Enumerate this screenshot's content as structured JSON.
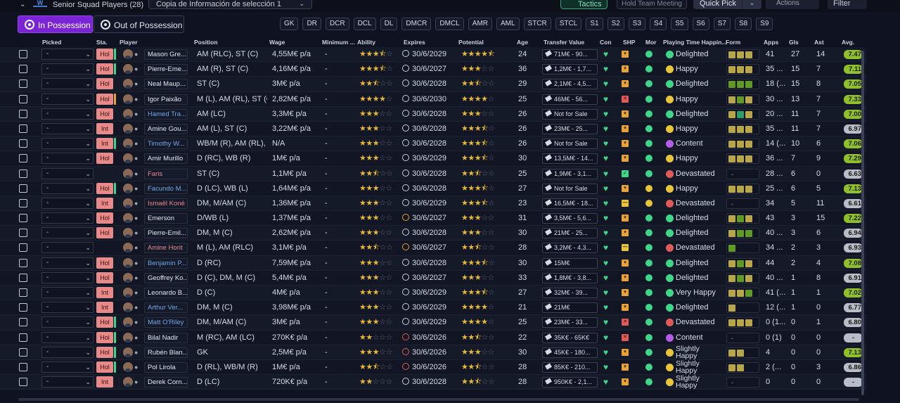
{
  "topbar": {
    "squad_title": "Senior Squad Players (28)",
    "selection_dropdown": "Copia de Información de selección 1",
    "tactics": "Tactics",
    "hold_team_meeting": "Hold Team Meeting",
    "quick_pick": "Quick Pick",
    "actions": "Actions",
    "filter": "Filter"
  },
  "possession": {
    "in": "In Possession",
    "out": "Out of Possession"
  },
  "positions": [
    "GK",
    "DR",
    "DCR",
    "DCL",
    "DL",
    "DMCR",
    "DMCL",
    "AMR",
    "AML",
    "STCR",
    "STCL",
    "S1",
    "S2",
    "S3",
    "S4",
    "S5",
    "S6",
    "S7",
    "S8",
    "S9"
  ],
  "columns": {
    "picked": "Picked",
    "sta": "Sta.",
    "player": "Player",
    "position": "Position",
    "wage": "Wage",
    "minimum": "Minimum ...",
    "ability": "Ability",
    "expires": "Expires",
    "potential": "Potential",
    "age": "Age",
    "transfer_value": "Transfer Value",
    "con": "Con",
    "shp": "SHP",
    "mor": "Mor",
    "happiness": "Playing Time Happin...",
    "form": "Form",
    "apps": "Apps",
    "gls": "Gls",
    "ast": "Ast",
    "avg": "Avg."
  },
  "colors": {
    "accent_purple": "#7a24d6",
    "tactics_green": "#2fa37a",
    "star": "#e8b931",
    "happy_green": "#3fd68a",
    "happy_yellow": "#e8c53a",
    "sad_red": "#e05a5a",
    "content_purple": "#b45be8"
  },
  "rows": [
    {
      "picked": "-",
      "sta": "Hol",
      "cond": "g",
      "name": "Mason Gre...",
      "name_color": "white",
      "position": "AM (RLC), ST (C)",
      "wage": "4,55M€ p/a",
      "min": "-",
      "ability": 3.5,
      "expires": "30/6/2029",
      "exp": "n",
      "potential": 4.5,
      "age": "24",
      "tv": "71M€ - 90...",
      "con": "g",
      "shp": "o",
      "mor": "g",
      "happy": "Delighted",
      "hc": "g",
      "form": [
        "y",
        "y",
        "y"
      ],
      "apps": "41",
      "gls": "27",
      "ast": "14",
      "avg": "7.47",
      "avgc": "#8fbf2a"
    },
    {
      "picked": "-",
      "sta": "Hol",
      "cond": "g",
      "name": "Pierre-Eme...",
      "name_color": "white",
      "position": "AM (R), ST (C)",
      "wage": "4,16M€ p/a",
      "min": "-",
      "ability": 3.5,
      "expires": "30/6/2027",
      "exp": "n",
      "potential": 3,
      "age": "36",
      "tv": "1,2M€ - 1,7...",
      "con": "g",
      "shp": "o",
      "mor": "g",
      "happy": "Happy",
      "hc": "y",
      "form": [
        "y",
        "y",
        "y"
      ],
      "apps": "35 ...",
      "gls": "15",
      "ast": "7",
      "avg": "7.11",
      "avgc": "#8fbf2a"
    },
    {
      "picked": "-",
      "sta": "Hol",
      "cond": "",
      "name": "Neal Maup...",
      "name_color": "white",
      "position": "ST (C)",
      "wage": "3M€ p/a",
      "min": "-",
      "ability": 2.5,
      "expires": "30/6/2028",
      "exp": "n",
      "potential": 2.5,
      "age": "29",
      "tv": "2,1M€ - 4,5...",
      "con": "g",
      "shp": "o",
      "mor": "g",
      "happy": "Delighted",
      "hc": "g",
      "form": [
        "g",
        "g",
        "g"
      ],
      "apps": "18 (...",
      "gls": "15",
      "ast": "8",
      "avg": "7.05",
      "avgc": "#8fbf2a"
    },
    {
      "picked": "-",
      "sta": "Hol",
      "cond": "o",
      "name": "Igor Paixão",
      "name_color": "white",
      "position": "M (L), AM (RL), ST (C)",
      "wage": "2,82M€ p/a",
      "min": "-",
      "ability": 4,
      "expires": "30/6/2030",
      "exp": "n",
      "potential": 4,
      "age": "25",
      "tv": "46M€ - 56...",
      "con": "g",
      "shp": "r",
      "mor": "g",
      "happy": "Happy",
      "hc": "y",
      "form": [
        "y",
        "g",
        "y"
      ],
      "apps": "30 ...",
      "gls": "13",
      "ast": "7",
      "avg": "7.33",
      "avgc": "#8fbf2a"
    },
    {
      "picked": "-",
      "sta": "Hol",
      "cond": "",
      "name": "Hamed Tra...",
      "name_color": "blue",
      "position": "AM (LC)",
      "wage": "3,3M€ p/a",
      "min": "-",
      "ability": 3,
      "expires": "30/6/2028",
      "exp": "n",
      "potential": 3,
      "age": "26",
      "tv": "Not for Sale",
      "con": "g",
      "shp": "o",
      "mor": "g",
      "happy": "Delighted",
      "hc": "g",
      "form": [
        "y",
        "t",
        "y"
      ],
      "apps": "20 ...",
      "gls": "11",
      "ast": "7",
      "avg": "7.00",
      "avgc": "#8fbf2a"
    },
    {
      "picked": "-",
      "sta": "Int",
      "cond": "",
      "name": "Amine Gou...",
      "name_color": "white",
      "position": "AM (L), ST (C)",
      "wage": "3,22M€ p/a",
      "min": "-",
      "ability": 3,
      "expires": "30/6/2028",
      "exp": "n",
      "potential": 3.5,
      "age": "26",
      "tv": "23M€ - 25...",
      "con": "g",
      "shp": "o",
      "mor": "g",
      "happy": "Happy",
      "hc": "y",
      "form": [
        "y",
        "y",
        "y"
      ],
      "apps": "35 ...",
      "gls": "11",
      "ast": "7",
      "avg": "6.97",
      "avgc": "#b8bdc9"
    },
    {
      "picked": "-",
      "sta": "Int",
      "cond": "g",
      "name": "Timothy W...",
      "name_color": "blue",
      "position": "WB/M (R), AM (RL), ...",
      "wage": "N/A",
      "min": "-",
      "ability": 3,
      "expires": "30/6/2028",
      "exp": "n",
      "potential": 3.5,
      "age": "26",
      "tv": "Not for Sale",
      "con": "g",
      "shp": "o",
      "mor": "g",
      "happy": "Content",
      "hc": "p",
      "form": [
        "y",
        "y",
        "y"
      ],
      "apps": "14 (...",
      "gls": "10",
      "ast": "6",
      "avg": "7.06",
      "avgc": "#8fbf2a"
    },
    {
      "picked": "-",
      "sta": "Hol",
      "cond": "",
      "name": "Amir Murillo",
      "name_color": "white",
      "position": "D (RC), WB (R)",
      "wage": "1M€ p/a",
      "min": "-",
      "ability": 3,
      "expires": "30/6/2029",
      "exp": "n",
      "potential": 3.5,
      "age": "30",
      "tv": "13,5M€ - 14...",
      "con": "g",
      "shp": "o",
      "mor": "g",
      "happy": "Happy",
      "hc": "y",
      "form": [
        "y",
        "y",
        "y"
      ],
      "apps": "36 ...",
      "gls": "7",
      "ast": "9",
      "avg": "7.29",
      "avgc": "#8fbf2a"
    },
    {
      "picked": "-",
      "sta": "",
      "cond": "",
      "name": "Faris",
      "name_color": "red",
      "position": "ST (C)",
      "wage": "1,1M€ p/a",
      "min": "-",
      "ability": 2.5,
      "expires": "30/6/2028",
      "exp": "n",
      "potential": 2.5,
      "age": "25",
      "tv": "1,9M€ - 3,1...",
      "con": "g",
      "shp": "gr",
      "mor": "g",
      "happy": "Devastated",
      "hc": "r",
      "form": [],
      "apps": "28 ...",
      "gls": "6",
      "ast": "0",
      "avg": "6.63",
      "avgc": "#b8bdc9"
    },
    {
      "picked": "-",
      "sta": "Hol",
      "cond": "g",
      "name": "Facundo M...",
      "name_color": "blue",
      "position": "D (LC), WB (L)",
      "wage": "1,64M€ p/a",
      "min": "-",
      "ability": 3,
      "expires": "30/6/2028",
      "exp": "n",
      "potential": 3.5,
      "age": "27",
      "tv": "Not for Sale",
      "con": "g",
      "shp": "o",
      "mor": "y",
      "happy": "Happy",
      "hc": "y",
      "form": [
        "y",
        "y",
        "y"
      ],
      "apps": "25 ...",
      "gls": "6",
      "ast": "5",
      "avg": "7.13",
      "avgc": "#8fbf2a"
    },
    {
      "picked": "-",
      "sta": "Int",
      "cond": "",
      "name": "Ismaël Koné",
      "name_color": "red",
      "position": "DM, M/AM (C)",
      "wage": "1,36M€ p/a",
      "min": "-",
      "ability": 3,
      "expires": "30/6/2029",
      "exp": "n",
      "potential": 3.5,
      "age": "23",
      "tv": "16,5M€ - 18...",
      "con": "g",
      "shp": "ye",
      "mor": "y",
      "happy": "Devastated",
      "hc": "r",
      "form": [],
      "apps": "34",
      "gls": "5",
      "ast": "11",
      "avg": "6.61",
      "avgc": "#b8bdc9"
    },
    {
      "picked": "-",
      "sta": "Hol",
      "cond": "",
      "name": "Emerson",
      "name_color": "white",
      "position": "D/WB (L)",
      "wage": "1,37M€ p/a",
      "min": "-",
      "ability": 3,
      "expires": "30/6/2027",
      "exp": "o",
      "potential": 3,
      "age": "31",
      "tv": "3,5M€ - 5,6...",
      "con": "g",
      "shp": "o",
      "mor": "g",
      "happy": "Delighted",
      "hc": "g",
      "form": [
        "y",
        "g",
        "y"
      ],
      "apps": "43",
      "gls": "3",
      "ast": "15",
      "avg": "7.22",
      "avgc": "#8fbf2a"
    },
    {
      "picked": "-",
      "sta": "Hol",
      "cond": "",
      "name": "Pierre-Emil...",
      "name_color": "white",
      "position": "DM, M (C)",
      "wage": "2,62M€ p/a",
      "min": "-",
      "ability": 3,
      "expires": "30/6/2028",
      "exp": "n",
      "potential": 3,
      "age": "30",
      "tv": "21M€ - 25...",
      "con": "g",
      "shp": "o",
      "mor": "g",
      "happy": "Delighted",
      "hc": "g",
      "form": [
        "y",
        "g",
        "g"
      ],
      "apps": "40 ...",
      "gls": "3",
      "ast": "6",
      "avg": "6.94",
      "avgc": "#b8bdc9"
    },
    {
      "picked": "-",
      "sta": "",
      "cond": "",
      "name": "Amine Horit",
      "name_color": "red",
      "position": "M (L), AM (RLC)",
      "wage": "3,1M€ p/a",
      "min": "-",
      "ability": 2.5,
      "expires": "30/6/2027",
      "exp": "o",
      "potential": 2.5,
      "age": "28",
      "tv": "3,2M€ - 4,3...",
      "con": "g",
      "shp": "ye",
      "mor": "g",
      "happy": "Devastated",
      "hc": "r",
      "form": [
        "g"
      ],
      "apps": "34 ...",
      "gls": "2",
      "ast": "3",
      "avg": "6.93",
      "avgc": "#b8bdc9"
    },
    {
      "picked": "-",
      "sta": "Hol",
      "cond": "",
      "name": "Benjamin P...",
      "name_color": "blue",
      "position": "D (RC)",
      "wage": "7,59M€ p/a",
      "min": "-",
      "ability": 3,
      "expires": "30/6/2028",
      "exp": "n",
      "potential": 3.5,
      "age": "30",
      "tv": "15M€",
      "con": "g",
      "shp": "o",
      "mor": "g",
      "happy": "Delighted",
      "hc": "g",
      "form": [
        "y",
        "g",
        "y"
      ],
      "apps": "44",
      "gls": "2",
      "ast": "4",
      "avg": "7.08",
      "avgc": "#8fbf2a"
    },
    {
      "picked": "-",
      "sta": "Hol",
      "cond": "",
      "name": "Geoffrey Ko...",
      "name_color": "white",
      "position": "D (C), DM, M (C)",
      "wage": "5,4M€ p/a",
      "min": "-",
      "ability": 3,
      "expires": "30/6/2027",
      "exp": "n",
      "potential": 3,
      "age": "33",
      "tv": "1,8M€ - 3,8...",
      "con": "g",
      "shp": "o",
      "mor": "g",
      "happy": "Delighted",
      "hc": "g",
      "form": [
        "y",
        "g",
        "y"
      ],
      "apps": "40 ...",
      "gls": "1",
      "ast": "8",
      "avg": "6.91",
      "avgc": "#b8bdc9"
    },
    {
      "picked": "-",
      "sta": "Int",
      "cond": "",
      "name": "Leonardo B...",
      "name_color": "white",
      "position": "D (C)",
      "wage": "4M€ p/a",
      "min": "-",
      "ability": 3,
      "expires": "30/6/2029",
      "exp": "n",
      "potential": 3.5,
      "age": "27",
      "tv": "32M€ - 39...",
      "con": "g",
      "shp": "o",
      "mor": "g",
      "happy": "Very Happy",
      "hc": "g",
      "form": [
        "y",
        "y",
        "g"
      ],
      "apps": "41 (...",
      "gls": "1",
      "ast": "1",
      "avg": "7.02",
      "avgc": "#8fbf2a"
    },
    {
      "picked": "-",
      "sta": "Int",
      "cond": "",
      "name": "Arthur Ver...",
      "name_color": "blue",
      "position": "DM, M (C)",
      "wage": "3,98M€ p/a",
      "min": "-",
      "ability": 3,
      "expires": "30/6/2029",
      "exp": "n",
      "potential": 4,
      "age": "21",
      "tv": "21M€",
      "con": "g",
      "shp": "o",
      "mor": "g",
      "happy": "Delighted",
      "hc": "g",
      "form": [
        "y"
      ],
      "apps": "12 (...",
      "gls": "1",
      "ast": "0",
      "avg": "6.77",
      "avgc": "#b8bdc9"
    },
    {
      "picked": "-",
      "sta": "Hol",
      "cond": "g",
      "name": "Matt O'Riley",
      "name_color": "blue",
      "position": "DM, M/AM (C)",
      "wage": "3M€ p/a",
      "min": "-",
      "ability": 3,
      "expires": "30/6/2029",
      "exp": "n",
      "potential": 4,
      "age": "25",
      "tv": "23M€ - 33...",
      "con": "g",
      "shp": "r",
      "mor": "g",
      "happy": "Devastated",
      "hc": "r",
      "form": [
        "y",
        "y",
        "y"
      ],
      "apps": "0 (1...",
      "gls": "0",
      "ast": "1",
      "avg": "6.80",
      "avgc": "#b8bdc9"
    },
    {
      "picked": "-",
      "sta": "Hol",
      "cond": "g",
      "name": "Bilal Nadir",
      "name_color": "white",
      "position": "M (RC), AM (LC)",
      "wage": "270K€ p/a",
      "min": "-",
      "ability": 2,
      "expires": "30/6/2026",
      "exp": "r",
      "potential": 2.5,
      "age": "22",
      "tv": "35K€ - 65K€",
      "con": "g",
      "shp": "r",
      "mor": "g",
      "happy": "Content",
      "hc": "p",
      "form": [],
      "apps": "0 (1)",
      "gls": "0",
      "ast": "0",
      "avg": "-",
      "avgc": "#b8bdc9"
    },
    {
      "picked": "-",
      "sta": "Hol",
      "cond": "g",
      "name": "Rubén Blan...",
      "name_color": "white",
      "position": "GK",
      "wage": "2,5M€ p/a",
      "min": "-",
      "ability": 3,
      "expires": "30/6/2026",
      "exp": "r",
      "potential": 3,
      "age": "30",
      "tv": "45K€ - 180...",
      "con": "g",
      "shp": "o",
      "mor": "g",
      "happy": "Slightly Happy",
      "hc": "y",
      "form": [
        "y",
        "y"
      ],
      "apps": "4",
      "gls": "0",
      "ast": "0",
      "avg": "7.13",
      "avgc": "#8fbf2a"
    },
    {
      "picked": "-",
      "sta": "Hol",
      "cond": "g",
      "name": "Pol Lirola",
      "name_color": "white",
      "position": "D (RL), WB/M (R)",
      "wage": "1M€ p/a",
      "min": "-",
      "ability": 2.5,
      "expires": "30/6/2026",
      "exp": "r",
      "potential": 2.5,
      "age": "28",
      "tv": "85K€ - 210...",
      "con": "g",
      "shp": "o",
      "mor": "g",
      "happy": "Slightly Happy",
      "hc": "y",
      "form": [
        "y",
        "y"
      ],
      "apps": "2 (...",
      "gls": "0",
      "ast": "3",
      "avg": "6.86",
      "avgc": "#b8bdc9"
    },
    {
      "picked": "-",
      "sta": "Int",
      "cond": "",
      "name": "Derek Corn...",
      "name_color": "white",
      "position": "D (LC)",
      "wage": "720K€ p/a",
      "min": "-",
      "ability": 2,
      "expires": "30/6/2028",
      "exp": "n",
      "potential": 2.5,
      "age": "28",
      "tv": "950K€ - 2,1...",
      "con": "g",
      "shp": "o",
      "mor": "g",
      "happy": "Slightly Happy",
      "hc": "y",
      "form": [],
      "apps": "0",
      "gls": "0",
      "ast": "0",
      "avg": "-",
      "avgc": "#b8bdc9"
    }
  ]
}
